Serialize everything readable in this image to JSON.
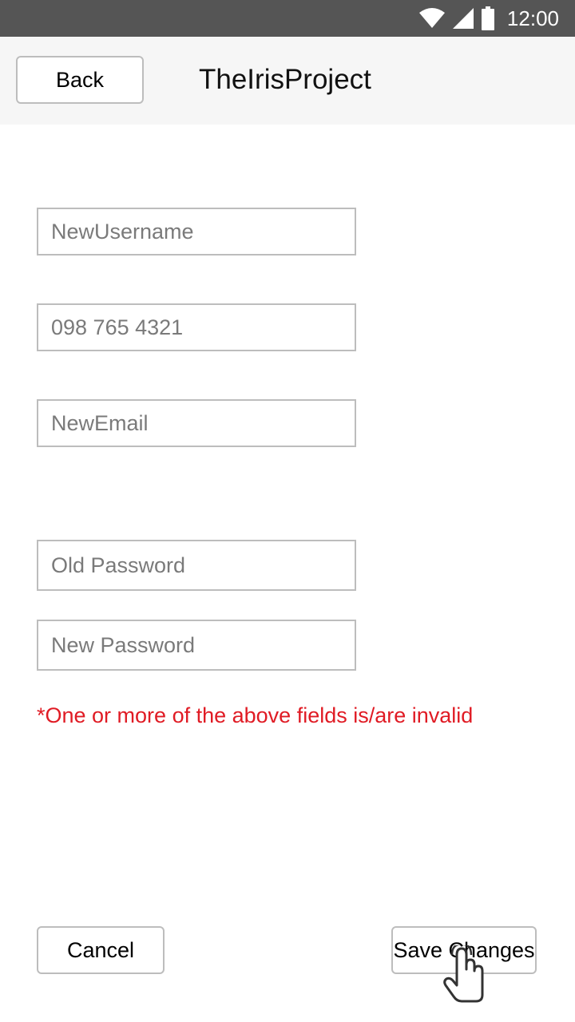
{
  "status_bar": {
    "time": "12:00",
    "icons": [
      "wifi-icon",
      "cell-signal-icon",
      "battery-icon"
    ]
  },
  "app_bar": {
    "back_label": "Back",
    "title": "TheIrisProject"
  },
  "form": {
    "username_placeholder": "NewUsername",
    "phone_placeholder": "098 765 4321",
    "email_placeholder": "NewEmail",
    "old_password_placeholder": "Old Password",
    "new_password_placeholder": "New Password",
    "error_message": "*One or more of the above fields is/are invalid"
  },
  "actions": {
    "cancel_label": "Cancel",
    "save_label": "Save Changes"
  },
  "colors": {
    "status_bar": "#555555",
    "app_bar": "#f6f6f6",
    "error": "#e01b24",
    "border": "#bdbdbd"
  }
}
